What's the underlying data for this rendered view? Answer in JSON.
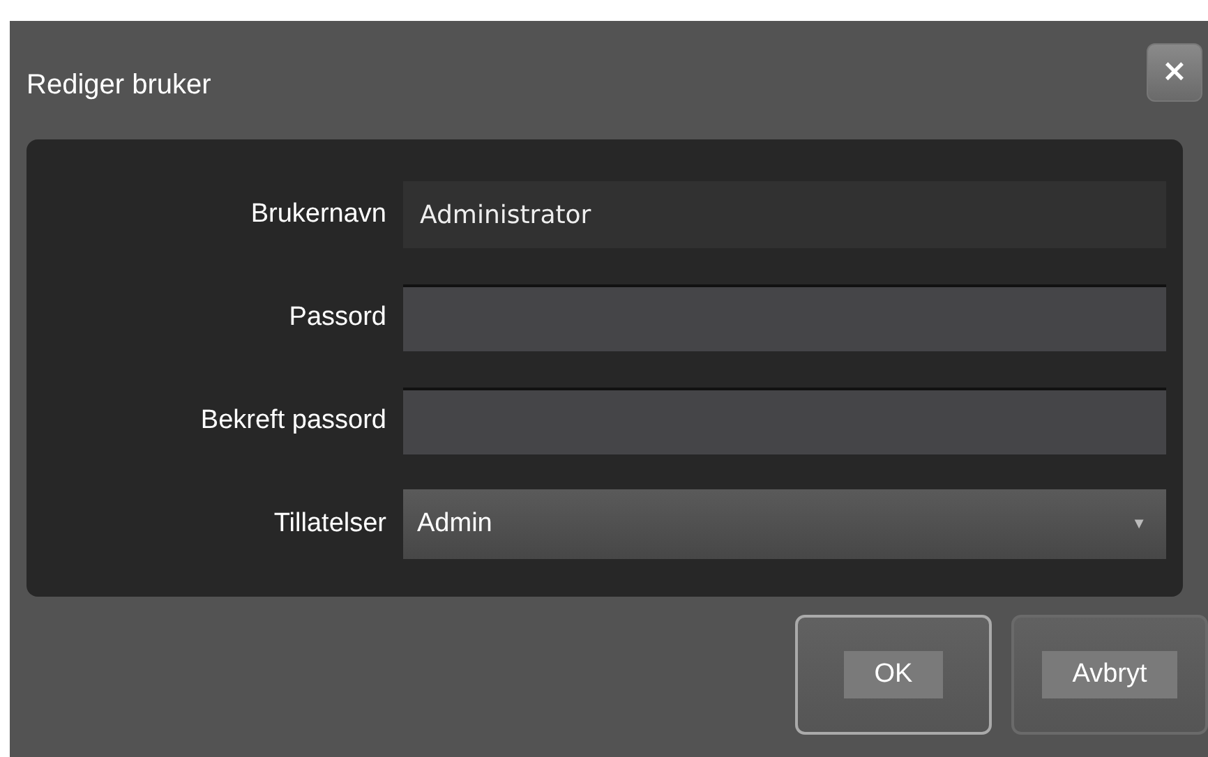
{
  "dialog": {
    "title": "Rediger bruker",
    "close_label": "×"
  },
  "fields": [
    {
      "label": "Brukernavn",
      "kind": "text",
      "value": "Administrator",
      "disabled": true
    },
    {
      "label": "Passord",
      "kind": "password",
      "disabled": false
    },
    {
      "label": "Bekreft passord",
      "kind": "password",
      "disabled": false
    },
    {
      "label": "Tillatelser",
      "kind": "select",
      "value": "Admin",
      "arrow": "▼"
    }
  ],
  "buttons": [
    {
      "label": "OK",
      "default": true
    },
    {
      "label": "Avbryt",
      "default": false
    }
  ]
}
